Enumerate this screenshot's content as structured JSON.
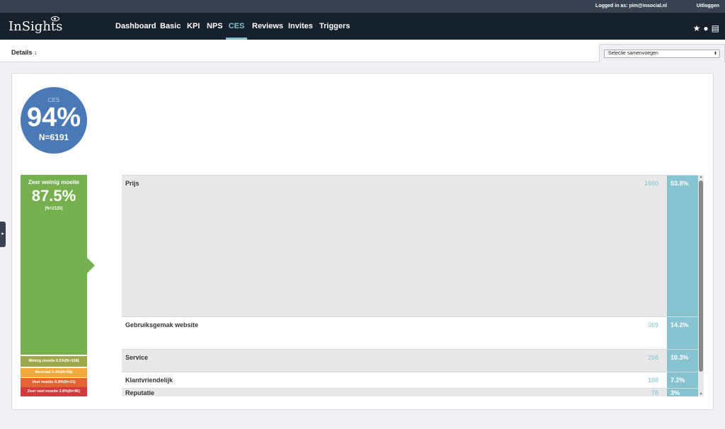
{
  "topbar": {
    "login_text": "Logged in as: pim@insocial.nl",
    "logout": "Uitloggen"
  },
  "brand": {
    "name": "InSights"
  },
  "nav": {
    "items": [
      {
        "label": "Dashboard"
      },
      {
        "label": "Basic"
      },
      {
        "label": "KPI"
      },
      {
        "label": "NPS"
      },
      {
        "label": "CES"
      },
      {
        "label": "Reviews"
      },
      {
        "label": "Invites"
      },
      {
        "label": "Triggers"
      }
    ],
    "active": "CES",
    "icons": [
      "star-icon",
      "chat-icon",
      "print-icon"
    ]
  },
  "subbar": {
    "details": "Details ↓",
    "select_value": "Selectie samenvoegen"
  },
  "score": {
    "label": "CES",
    "value": "94%",
    "n": "N=6191"
  },
  "distribution": {
    "main": {
      "label": "Zeer weinig moeite",
      "pct": "87.5%",
      "n": "(N=2135)"
    },
    "others": [
      {
        "text": "Weinig moeite 6.5%(N=158)",
        "color": "#9fa84a"
      },
      {
        "text": "Neutraal 2.4%(N=58)",
        "color": "#f0a83c"
      },
      {
        "text": "Veel moeite 0.9%(N=21)",
        "color": "#e16434"
      },
      {
        "text": "Zeer veel moeite 2.8%(N=96)",
        "color": "#d33a3d"
      }
    ]
  },
  "topics": [
    {
      "name": "Prijs",
      "count": "1660",
      "pct": "53.8%"
    },
    {
      "name": "Gebruiksgemak website",
      "count": "369",
      "pct": "14.2%"
    },
    {
      "name": "Service",
      "count": "268",
      "pct": "10.3%"
    },
    {
      "name": "Klantvriendelijk",
      "count": "188",
      "pct": "7.2%"
    },
    {
      "name": "Reputatie",
      "count": "78",
      "pct": "3%"
    }
  ]
}
